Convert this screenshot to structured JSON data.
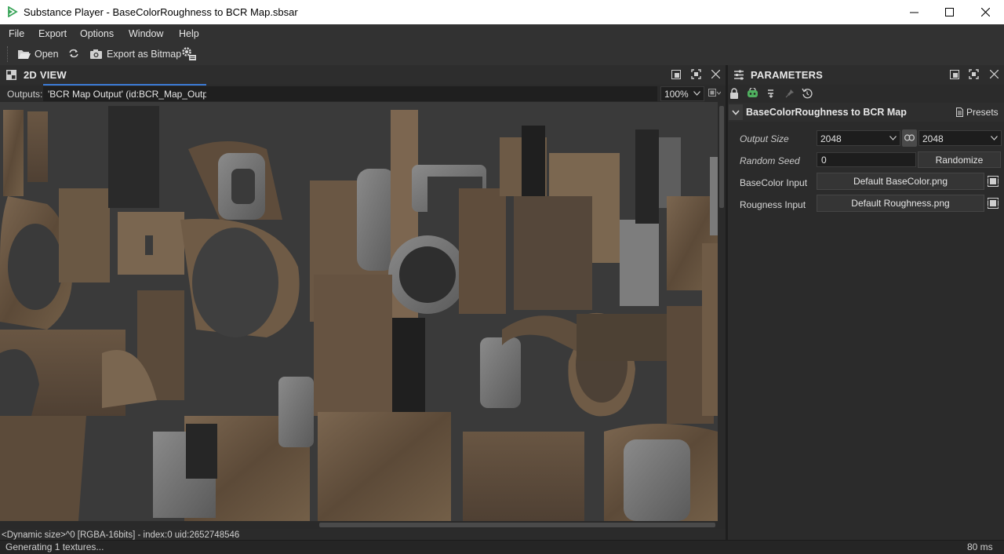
{
  "window": {
    "title": "Substance Player - BaseColorRoughness to BCR Map.sbsar"
  },
  "menu": [
    "File",
    "Export",
    "Options",
    "Window",
    "Help"
  ],
  "toolbar": {
    "open_label": "Open",
    "export_label": "Export as Bitmap"
  },
  "view2d": {
    "title": "2D VIEW",
    "outputs_label": "Outputs:",
    "output_value": "'BCR Map Output' (id:BCR_Map_Output)",
    "zoom_value": "100%",
    "info_line": "<Dynamic size>^0 [RGBA-16bits] - index:0 uid:2652748546"
  },
  "parameters": {
    "title": "PARAMETERS",
    "group_title": "BaseColorRoughness to BCR Map",
    "presets_label": "Presets",
    "output_size_label": "Output Size",
    "output_size_w": "2048",
    "output_size_h": "2048",
    "random_seed_label": "Random Seed",
    "random_seed_value": "0",
    "randomize_label": "Randomize",
    "basecolor_label": "BaseColor Input",
    "basecolor_value": "Default BaseColor.png",
    "roughness_label": "Rougness Input",
    "roughness_value": "Default Roughness.png"
  },
  "status": {
    "text": "Generating 1 textures...",
    "time": "80 ms"
  },
  "colors": {
    "accent": "#3c7bd6",
    "panel_bg": "#2b2b2b",
    "canvas_bg": "#3a3a3a",
    "texture_brown": "#6e5a44"
  }
}
